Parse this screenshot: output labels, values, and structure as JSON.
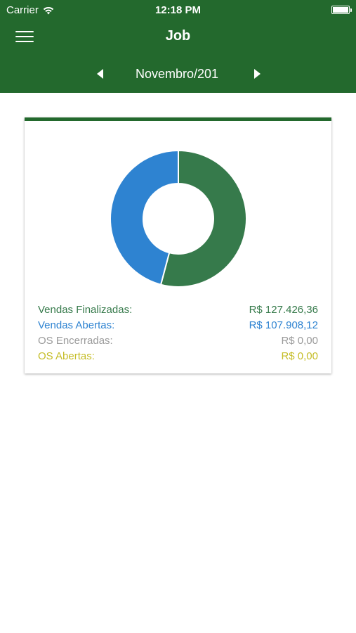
{
  "status_bar": {
    "carrier": "Carrier",
    "time": "12:18 PM"
  },
  "header": {
    "title": "Job",
    "month": "Novembro/201"
  },
  "colors": {
    "brand": "#23692d",
    "vendas_finalizadas": "#367a4b",
    "vendas_abertas": "#2e83d1",
    "os_encerradas": "#9a9a9a",
    "os_abertas": "#c5bd27"
  },
  "summary": {
    "rows": [
      {
        "label": "Vendas Finalizadas:",
        "value": "R$ 127.426,36",
        "amount": 127426.36,
        "color": "#367a4b"
      },
      {
        "label": "Vendas Abertas:",
        "value": "R$ 107.908,12",
        "amount": 107908.12,
        "color": "#2e83d1"
      },
      {
        "label": "OS Encerradas:",
        "value": "R$ 0,00",
        "amount": 0,
        "color": "#9a9a9a"
      },
      {
        "label": "OS Abertas:",
        "value": "R$ 0,00",
        "amount": 0,
        "color": "#c5bd27"
      }
    ]
  },
  "icons": {
    "menu": "hamburger-menu-icon",
    "prev": "triangle-left-icon",
    "next": "triangle-right-icon",
    "wifi": "wifi-icon",
    "battery": "battery-icon"
  }
}
